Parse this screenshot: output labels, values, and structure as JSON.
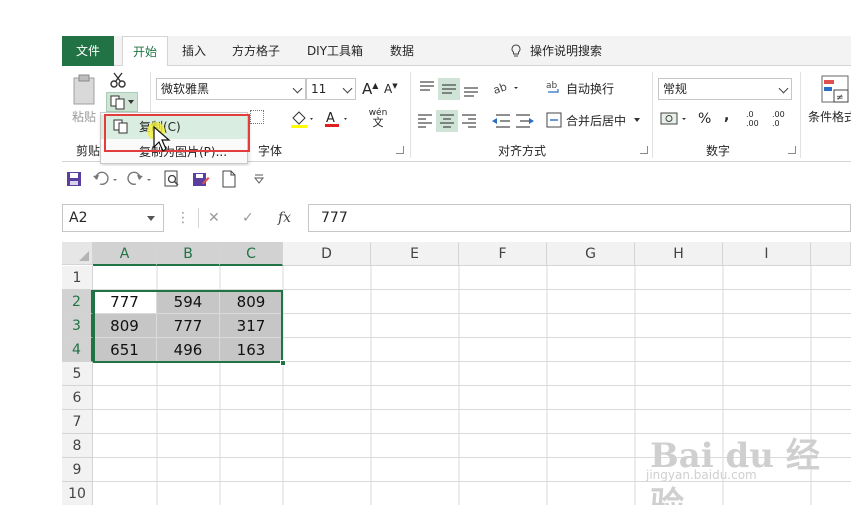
{
  "tabs": {
    "file": "文件",
    "home": "开始",
    "insert": "插入",
    "ffgz": "方方格子",
    "diy": "DIY工具箱",
    "data": "数据",
    "tell_me": "操作说明搜索"
  },
  "ribbon": {
    "clipboard": {
      "paste": "粘贴",
      "group_label": "剪贴"
    },
    "font": {
      "name": "微软雅黑",
      "size": "11",
      "group_label": "字体",
      "phonetic": "wén",
      "phonetic_char": "文"
    },
    "alignment": {
      "wrap_text": "自动换行",
      "merge_center": "合并后居中",
      "group_label": "对齐方式"
    },
    "number": {
      "format": "常规",
      "percent": "%",
      "comma": ",",
      "group_label": "数字",
      "inc_decimal": ".0 .00",
      "dec_decimal": ".00 .0"
    },
    "styles": {
      "conditional": "条件格式"
    }
  },
  "copy_menu": {
    "copy_label": "复制(C)",
    "copy_as_picture_label": "复制为图片(P)..."
  },
  "formula_bar": {
    "name_box": "A2",
    "fx": "fx",
    "value": "777"
  },
  "grid": {
    "columns": [
      "A",
      "B",
      "C",
      "D",
      "E",
      "F",
      "G",
      "H",
      "I"
    ],
    "rows": [
      "1",
      "2",
      "3",
      "4",
      "5",
      "6",
      "7",
      "8",
      "9",
      "10"
    ],
    "cells": [
      [
        "",
        "",
        ""
      ],
      [
        "777",
        "594",
        "809"
      ],
      [
        "809",
        "777",
        "317"
      ],
      [
        "651",
        "496",
        "163"
      ]
    ]
  },
  "watermark": {
    "brand": "Bai du 经验",
    "url": "jingyan.baidu.com"
  },
  "colors": {
    "accent": "#217346",
    "highlight": "#e23c3c",
    "selected_fill": "#c6c6c6"
  }
}
